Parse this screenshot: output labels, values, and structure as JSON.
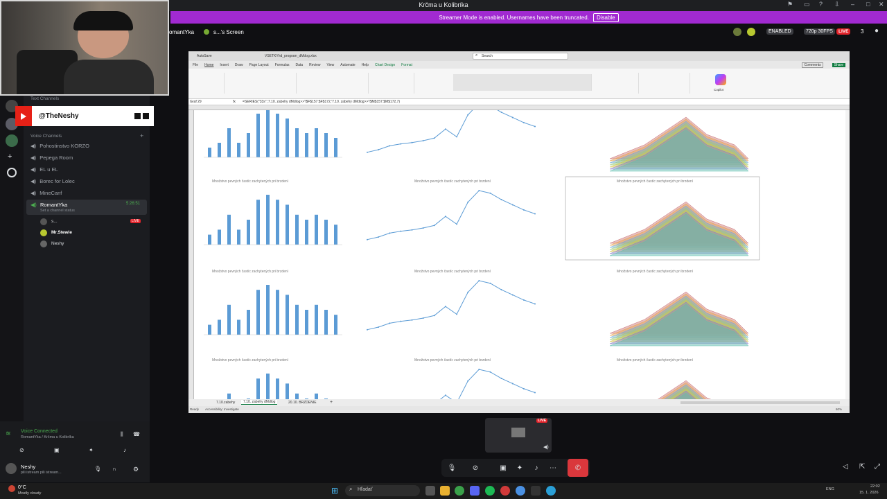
{
  "window": {
    "title": "Krčma u Kolibríka"
  },
  "banner": {
    "text": "Streamer Mode is enabled. Usernames have been truncated.",
    "button": "Disable"
  },
  "streambar": {
    "channel": "omantYka",
    "screen_label": "s...'s Screen",
    "enabled_badge": "ENABLED",
    "quality": "720p 30FPS",
    "live": "LIVE",
    "viewers": "3"
  },
  "youtube": {
    "handle": "@TheNeshy"
  },
  "sidebar": {
    "text_channels_header": "Text Channels",
    "voice_channels_header": "Voice Channels",
    "voice_channels": [
      {
        "name": "Pohostinstvo KORZO"
      },
      {
        "name": "Pepega Room"
      },
      {
        "name": "EL u EL"
      },
      {
        "name": "Borec for Lolec"
      },
      {
        "name": "MineCanf"
      }
    ],
    "active_channel": {
      "name": "RomantYka",
      "timer": "5:26:51",
      "status": "Set a channel status"
    },
    "members": [
      {
        "name": "s...",
        "badge": "LIVE"
      },
      {
        "name": "Mr.Stewie",
        "badge": ""
      },
      {
        "name": "Neshy",
        "badge": ""
      }
    ]
  },
  "voice": {
    "status": "Voice Connected",
    "location": "RomantYka / Krčma u Kolibríka"
  },
  "user": {
    "name": "Neshy",
    "status": "pili istream pili istream..."
  },
  "excel": {
    "autosave": "AutoSave",
    "filename": "VSETKYhd_program_dMdog.xlsx",
    "search": "Search",
    "tabs": [
      "File",
      "Home",
      "Insert",
      "Draw",
      "Page Layout",
      "Formulas",
      "Data",
      "Review",
      "View",
      "Automate",
      "Help",
      "Chart Design",
      "Format"
    ],
    "name_box": "Graf 29",
    "formula": "=SERIES(\"33s\",'7.10. zabehy dMdlog>>'!$F$157:$F$172,'7.10. zabehy dMdlog>>'!$M$157:$M$172,7)",
    "sheet_tabs": [
      "7.10.zabehy",
      "7.10. zabehy dMdlog",
      "20.10. BRZDENIE"
    ],
    "status_left": "Ready",
    "status_access": "Accessibility: Investigate",
    "zoom": "60%",
    "comments": "Comments",
    "share": "Share",
    "copilot": "Copilot"
  },
  "chart_title": "Množstvo pevných častíc zachytených pri brzdení",
  "bar_values": [
    2,
    3,
    6,
    3,
    5,
    9,
    10,
    9,
    8,
    6,
    5,
    6,
    5,
    4
  ],
  "line_values": [
    1,
    1.4,
    2,
    2.3,
    2.5,
    2.8,
    3.2,
    4.6,
    3.4,
    6.8,
    8.6,
    8.2,
    7.2,
    6.4,
    5.6,
    5.0
  ],
  "taskbar": {
    "weather_temp": "0°C",
    "weather_text": "Mostly cloudy",
    "search": "Hľadať",
    "lang": "ENG",
    "time": "22:02",
    "date": "15. 1. 2026"
  }
}
